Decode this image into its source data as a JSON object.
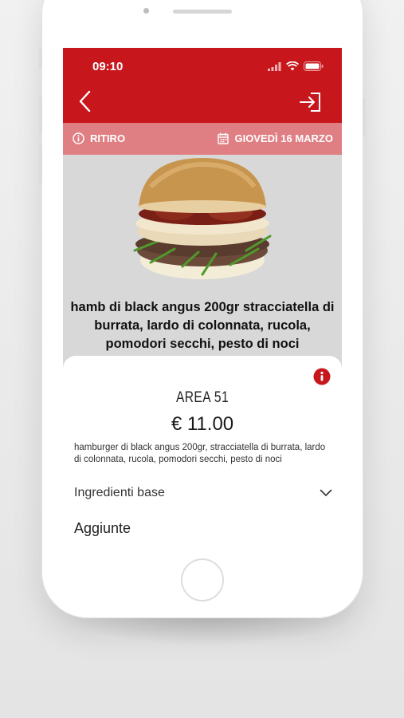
{
  "status_bar": {
    "time": "09:10"
  },
  "header": {
    "back_icon": "chevron-left-icon",
    "login_icon": "login-arrow-icon",
    "color": "#c8161d"
  },
  "subbar": {
    "mode": "RITIRO",
    "date": "GIOVEDÌ 16 MARZO",
    "color": "#e07f83"
  },
  "product": {
    "title": "hamb di black angus 200gr stracciatella di burrata, lardo di colonnata, rucola, pomodori secchi, pesto di noci",
    "name": "AREA 51",
    "price": "€ 11.00",
    "description": "hamburger di black angus 200gr, stracciatella di burrata, lardo di colonnata, rucola, pomodori secchi, pesto di noci"
  },
  "sections": {
    "ingredienti_label": "Ingredienti base",
    "aggiunte_label": "Aggiunte"
  }
}
